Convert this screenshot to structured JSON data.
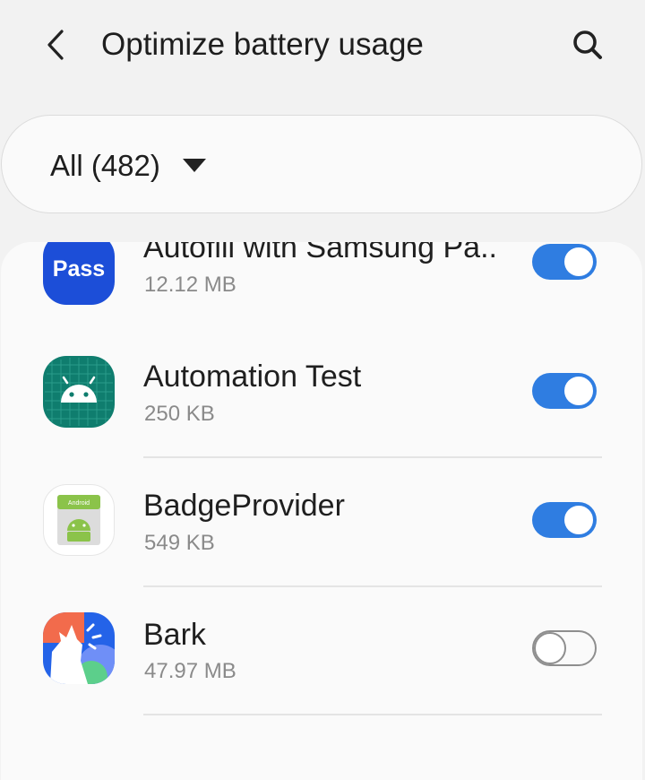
{
  "header": {
    "title": "Optimize battery usage",
    "back_icon": "back-arrow-icon",
    "search_icon": "search-icon"
  },
  "filter": {
    "label": "All (482)",
    "caret_icon": "dropdown-caret-icon"
  },
  "apps": [
    {
      "name": "Autofill with Samsung Pa..",
      "size": "12.12 MB",
      "icon": "samsung-pass-icon",
      "optimized": true
    },
    {
      "name": "Automation Test",
      "size": "250 KB",
      "icon": "android-grid-icon",
      "optimized": true
    },
    {
      "name": "BadgeProvider",
      "size": "549 KB",
      "icon": "android-badge-icon",
      "optimized": true
    },
    {
      "name": "Bark",
      "size": "47.97 MB",
      "icon": "bark-icon",
      "optimized": false
    }
  ],
  "colors": {
    "accent": "#2f7de1",
    "background": "#f2f2f2",
    "card": "#fafafa"
  }
}
